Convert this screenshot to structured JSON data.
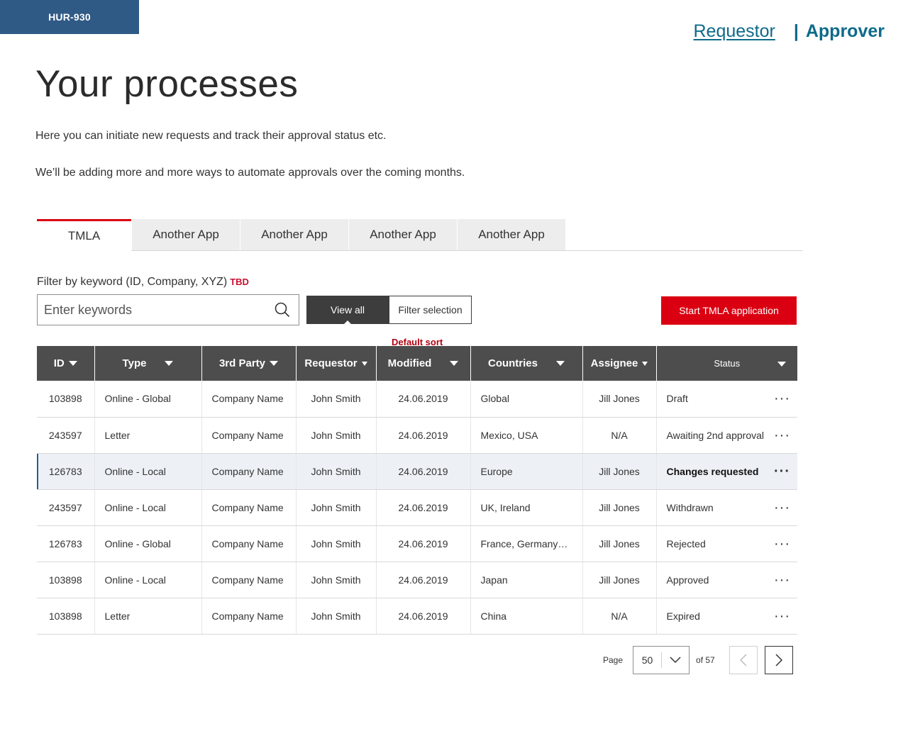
{
  "ticket": "HUR-930",
  "roles": {
    "requestor": "Requestor",
    "separator": "|",
    "approver": "Approver"
  },
  "page": {
    "title": "Your processes",
    "intro1": "Here you can initiate new requests and track their approval status etc.",
    "intro2": "We’ll be adding more and more ways to automate approvals over the coming months."
  },
  "tabs": [
    "TMLA",
    "Another App",
    "Another App",
    "Another App",
    "Another App"
  ],
  "filter": {
    "label": "Filter by keyword (ID, Company, XYZ)",
    "tbd": "TBD",
    "placeholder": "Enter keywords",
    "view_all": "View all",
    "filter_selection": "Filter selection"
  },
  "start_button": "Start TMLA application",
  "default_sort": "Default sort",
  "columns": [
    "ID",
    "Type",
    "3rd Party",
    "Requestor",
    "Modified",
    "Countries",
    "Assignee",
    "Status"
  ],
  "rows": [
    {
      "id": "103898",
      "type": "Online - Global",
      "party": "Company Name",
      "requestor": "John Smith",
      "modified": "24.06.2019",
      "countries": "Global",
      "assignee": "Jill Jones",
      "status": "Draft"
    },
    {
      "id": "243597",
      "type": "Letter",
      "party": "Company Name",
      "requestor": "John Smith",
      "modified": "24.06.2019",
      "countries": "Mexico, USA",
      "assignee": "N/A",
      "status": "Awaiting 2nd approval"
    },
    {
      "id": "126783",
      "type": "Online - Local",
      "party": "Company Name",
      "requestor": "John Smith",
      "modified": "24.06.2019",
      "countries": "Europe",
      "assignee": "Jill Jones",
      "status": "Changes requested"
    },
    {
      "id": "243597",
      "type": "Online - Local",
      "party": "Company Name",
      "requestor": "John Smith",
      "modified": "24.06.2019",
      "countries": "UK, Ireland",
      "assignee": "Jill Jones",
      "status": "Withdrawn"
    },
    {
      "id": "126783",
      "type": "Online - Global",
      "party": "Company Name",
      "requestor": "John Smith",
      "modified": "24.06.2019",
      "countries": "France, Germany…",
      "assignee": "Jill Jones",
      "status": "Rejected"
    },
    {
      "id": "103898",
      "type": "Online - Local",
      "party": "Company Name",
      "requestor": "John Smith",
      "modified": "24.06.2019",
      "countries": "Japan",
      "assignee": "Jill Jones",
      "status": "Approved"
    },
    {
      "id": "103898",
      "type": "Letter",
      "party": "Company Name",
      "requestor": "John Smith",
      "modified": "24.06.2019",
      "countries": "China",
      "assignee": "N/A",
      "status": "Expired"
    }
  ],
  "pagination": {
    "page_label": "Page",
    "page_size": "50",
    "of_label": "of 57"
  },
  "colors": {
    "brand_red": "#db0011",
    "header_grey": "#4d4d4d",
    "link_teal": "#0e6a8a",
    "ticket_blue": "#305a86"
  }
}
